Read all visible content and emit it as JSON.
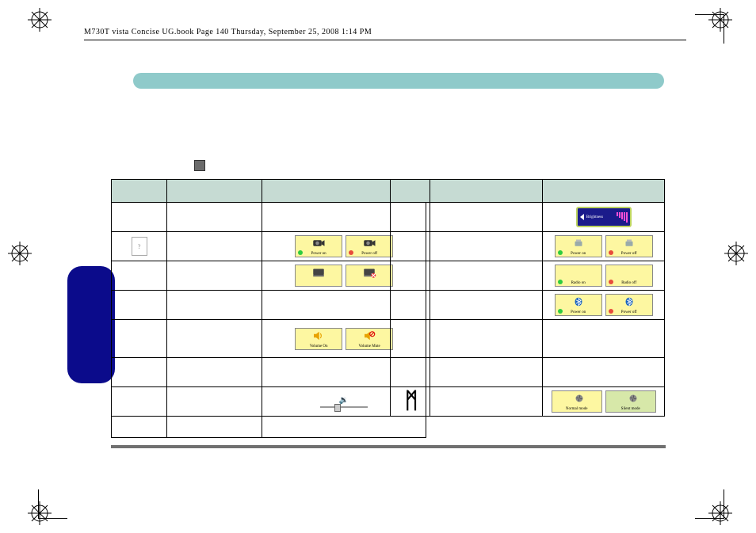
{
  "header": {
    "text": "M730T vista Concise UG.book  Page 140  Thursday, September 25, 2008  1:14 PM"
  },
  "brightness": {
    "label": "Brightness"
  },
  "left_table": {
    "camera": {
      "on_label": "Power on",
      "off_label": "Power off"
    },
    "volume": {
      "on_label": "Volume   On",
      "mute_label": "Volume   Mute"
    }
  },
  "right_table": {
    "wlan": {
      "on_label": "Power on",
      "off_label": "Power off"
    },
    "radio": {
      "on_label": "Radio on",
      "off_label": "Radio off"
    },
    "bt": {
      "on_label": "Power on",
      "off_label": "Power off"
    },
    "mode": {
      "normal_label": "Normal mode",
      "silent_label": "Silent mode"
    }
  }
}
